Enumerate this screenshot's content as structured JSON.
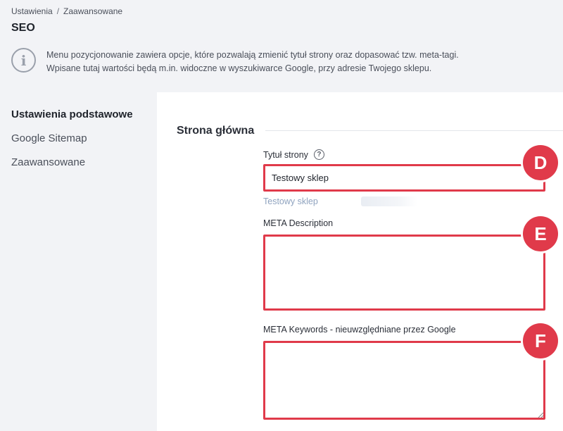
{
  "breadcrumb": {
    "item1": "Ustawienia",
    "separator": "/",
    "item2": "Zaawansowane"
  },
  "page": {
    "title": "SEO"
  },
  "info": {
    "icon": "info-icon",
    "line1": "Menu pozycjonowanie zawiera opcje, które pozwalają zmienić tytuł strony oraz dopasować tzw. meta-tagi.",
    "line2": "Wpisane tutaj wartości będą m.in. widoczne w wyszukiwarce Google, przy adresie Twojego sklepu."
  },
  "sidebar": {
    "items": [
      {
        "label": "Ustawienia podstawowe",
        "active": true
      },
      {
        "label": "Google Sitemap",
        "active": false
      },
      {
        "label": "Zaawansowane",
        "active": false
      }
    ]
  },
  "main": {
    "section_title": "Strona główna",
    "page_title_field": {
      "label": "Tytuł strony",
      "help_icon": "?",
      "value": "Testowy sklep"
    },
    "preview": "Testowy sklep",
    "meta_description": {
      "label": "META Description",
      "value": ""
    },
    "meta_keywords": {
      "label": "META Keywords - nieuwzględniane przez Google",
      "value": ""
    }
  },
  "badges": {
    "d": "D",
    "e": "E",
    "f": "F"
  },
  "colors": {
    "accent": "#e03a4a",
    "background": "#f2f3f6",
    "panel": "#ffffff",
    "preview": "#8fa3bf"
  }
}
